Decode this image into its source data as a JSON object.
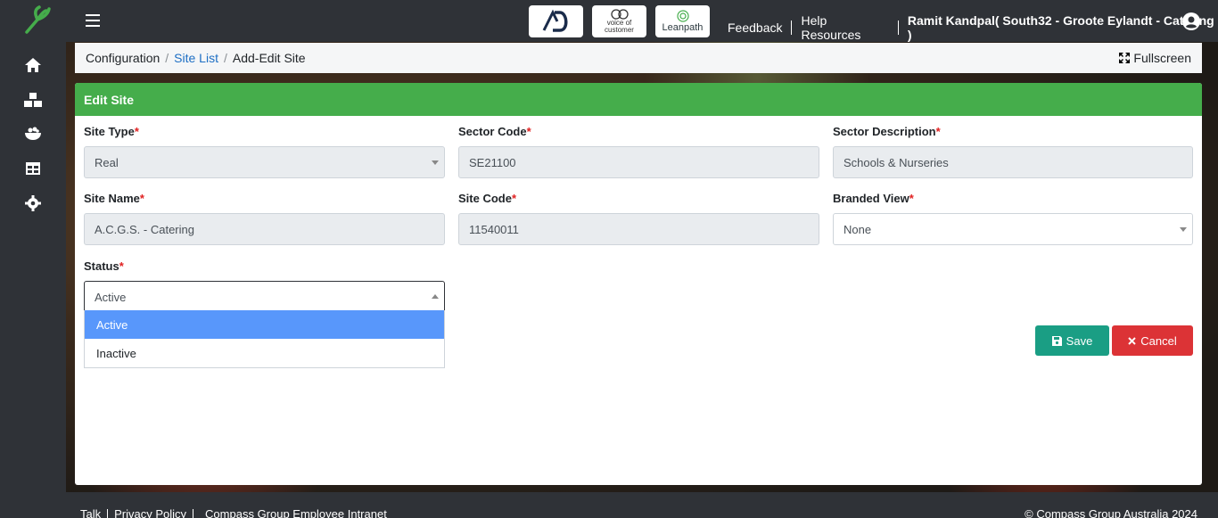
{
  "header": {
    "app_logos": [
      "AD",
      "voice of customer",
      "Leanpath"
    ],
    "feedback": "Feedback",
    "help": "Help Resources",
    "user": "Ramit Kandpal( South32 - Groote Eylandt - Catering )"
  },
  "sidebar": {
    "items": [
      {
        "icon": "home-icon"
      },
      {
        "icon": "boxes-icon"
      },
      {
        "icon": "food-bowl-icon"
      },
      {
        "icon": "table-icon"
      },
      {
        "icon": "gear-icon"
      }
    ]
  },
  "breadcrumb": {
    "items": [
      "Configuration",
      "Site List",
      "Add-Edit Site"
    ],
    "fullscreen": "Fullscreen"
  },
  "form": {
    "title": "Edit Site",
    "site_type": {
      "label": "Site Type",
      "value": "Real"
    },
    "sector_code": {
      "label": "Sector Code",
      "value": "SE21100"
    },
    "sector_description": {
      "label": "Sector Description",
      "value": "Schools & Nurseries"
    },
    "site_name": {
      "label": "Site Name",
      "value": "A.C.G.S. - Catering"
    },
    "site_code": {
      "label": "Site Code",
      "value": "11540011"
    },
    "branded_view": {
      "label": "Branded View",
      "value": "None"
    },
    "status": {
      "label": "Status",
      "value": "Active",
      "options": [
        "Active",
        "Inactive"
      ]
    },
    "required_mark": "*",
    "save": "Save",
    "cancel": "Cancel"
  },
  "footer": {
    "links": [
      "Talk",
      "Privacy Policy",
      "Compass Group Employee Intranet"
    ],
    "copyright": "© Compass Group Australia 2024"
  },
  "colors": {
    "header_green": "#45ad4b",
    "save": "#1a9e84",
    "cancel": "#dc3336",
    "link": "#1e6fc4",
    "selected_option": "#5897fb"
  }
}
